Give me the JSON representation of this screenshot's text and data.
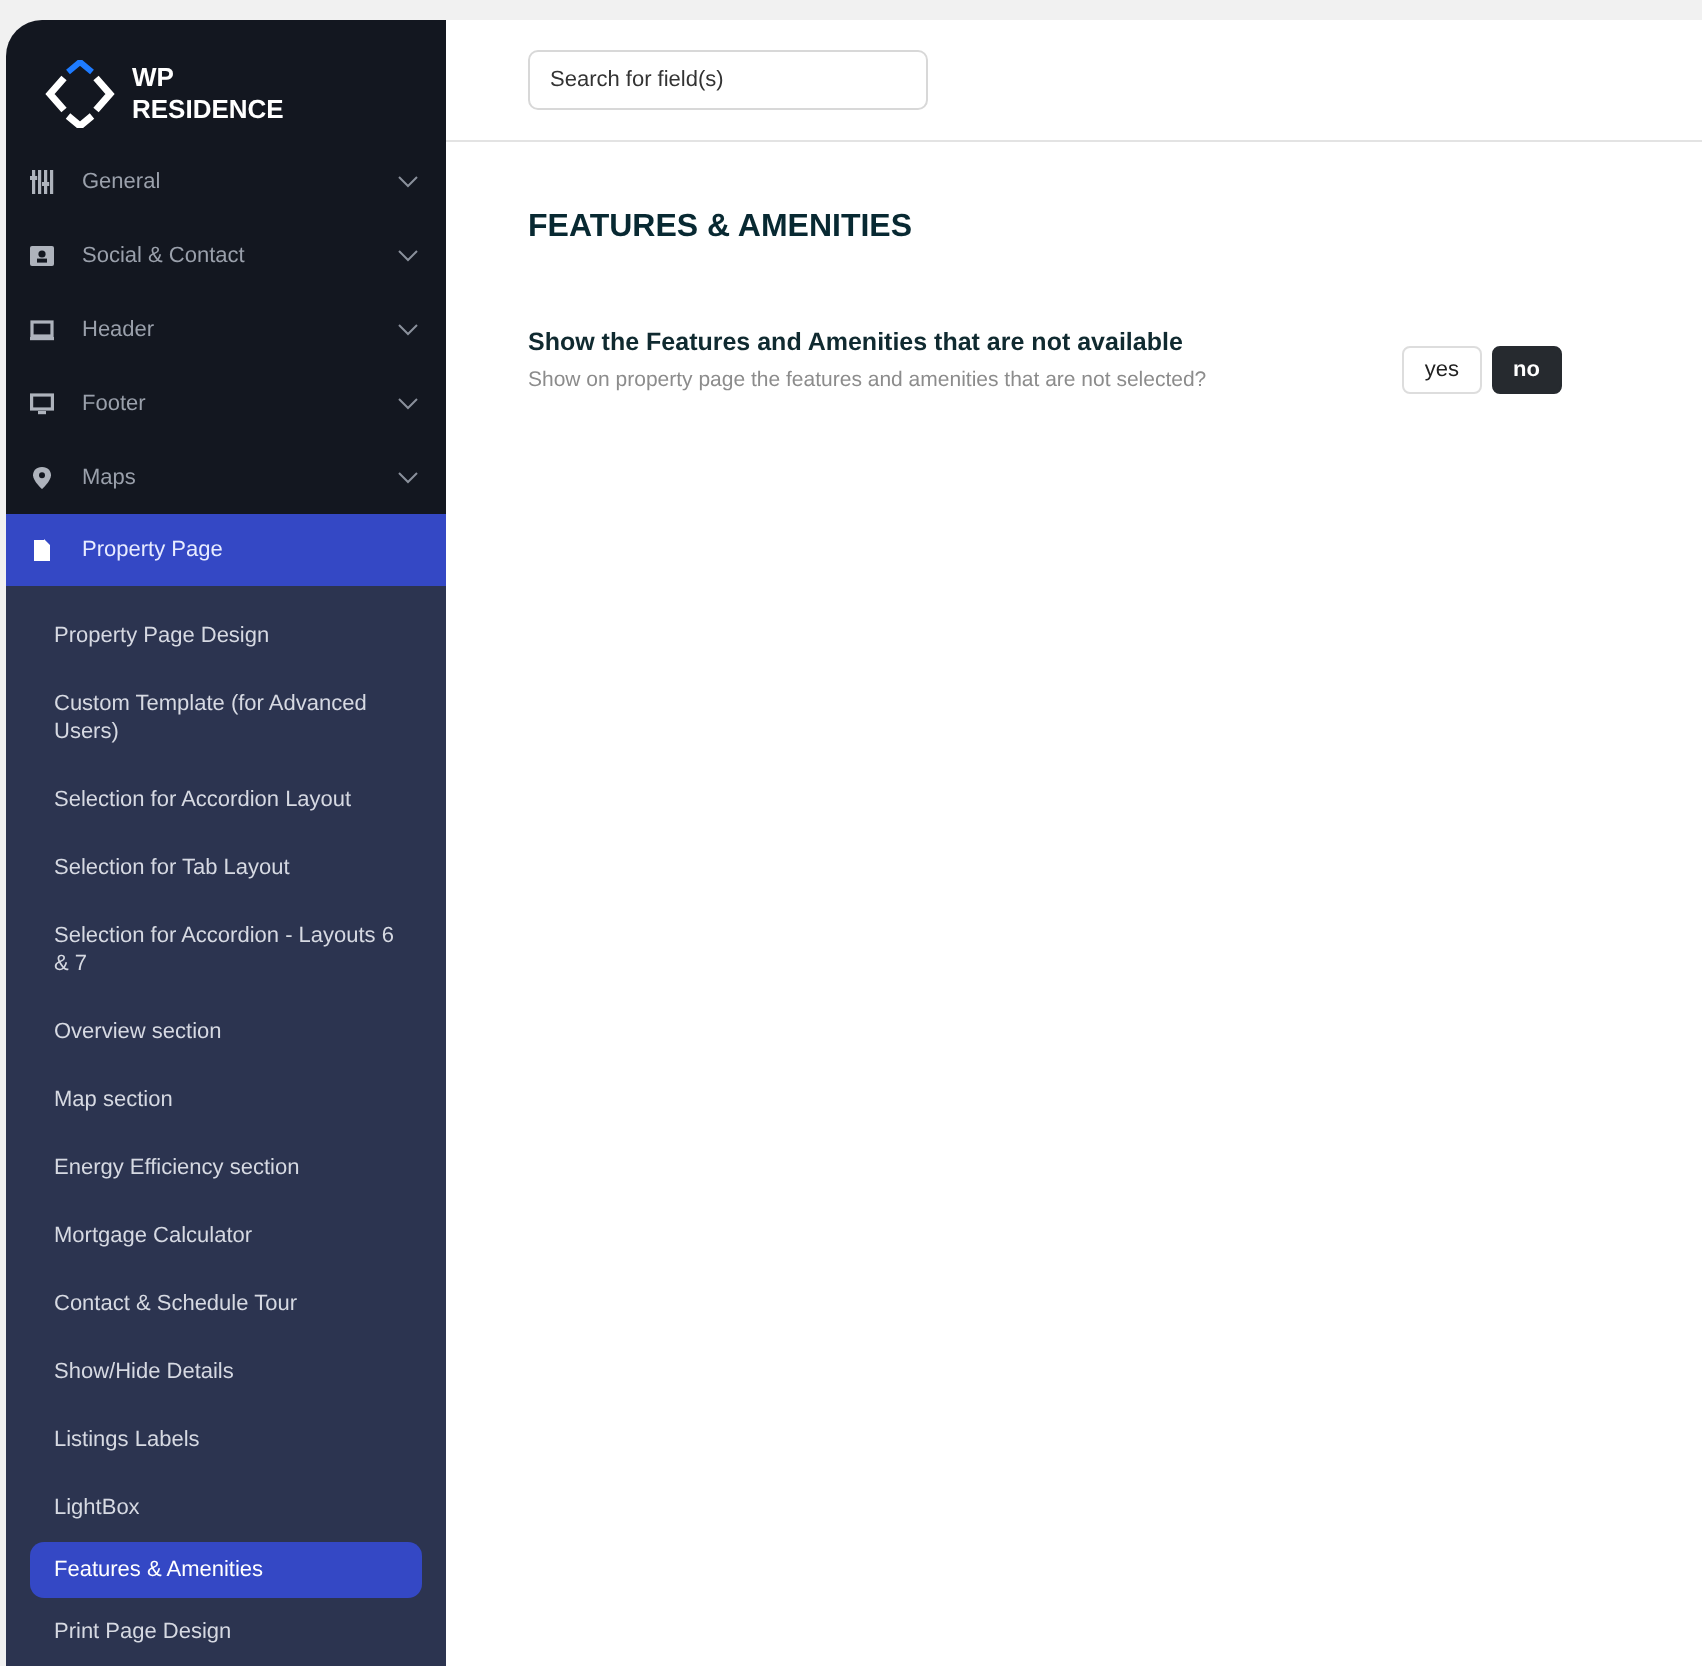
{
  "logo": {
    "line1": "WP",
    "line2": "RESIDENCE"
  },
  "search": {
    "placeholder": "Search for field(s)"
  },
  "sidebar": {
    "items": [
      {
        "label": "General",
        "selected": false,
        "expanded": false
      },
      {
        "label": "Social & Contact",
        "selected": false,
        "expanded": false
      },
      {
        "label": "Header",
        "selected": false,
        "expanded": false
      },
      {
        "label": "Footer",
        "selected": false,
        "expanded": false
      },
      {
        "label": "Maps",
        "selected": false,
        "expanded": false
      },
      {
        "label": "Property Page",
        "selected": true,
        "expanded": true,
        "children": [
          {
            "label": "Property Page Design",
            "selected": false
          },
          {
            "label": "Custom Template (for Advanced Users)",
            "selected": false
          },
          {
            "label": "Selection for Accordion Layout",
            "selected": false
          },
          {
            "label": "Selection for Tab Layout",
            "selected": false
          },
          {
            "label": "Selection for Accordion - Layouts 6 & 7",
            "selected": false
          },
          {
            "label": "Overview section",
            "selected": false
          },
          {
            "label": "Map section",
            "selected": false
          },
          {
            "label": "Energy Efficiency section",
            "selected": false
          },
          {
            "label": "Mortgage Calculator",
            "selected": false
          },
          {
            "label": "Contact & Schedule Tour",
            "selected": false
          },
          {
            "label": "Show/Hide Details",
            "selected": false
          },
          {
            "label": "Listings Labels",
            "selected": false
          },
          {
            "label": "LightBox",
            "selected": false
          },
          {
            "label": "Features & Amenities",
            "selected": true
          },
          {
            "label": "Print Page Design",
            "selected": false
          }
        ]
      }
    ]
  },
  "page_title": "FEATURES & AMENITIES",
  "settings": [
    {
      "title": "Show the Features and Amenities that are not available",
      "description": "Show on property page the features and amenities that are not selected?",
      "options": [
        {
          "label": "yes",
          "selected": false
        },
        {
          "label": "no",
          "selected": true
        }
      ]
    }
  ]
}
